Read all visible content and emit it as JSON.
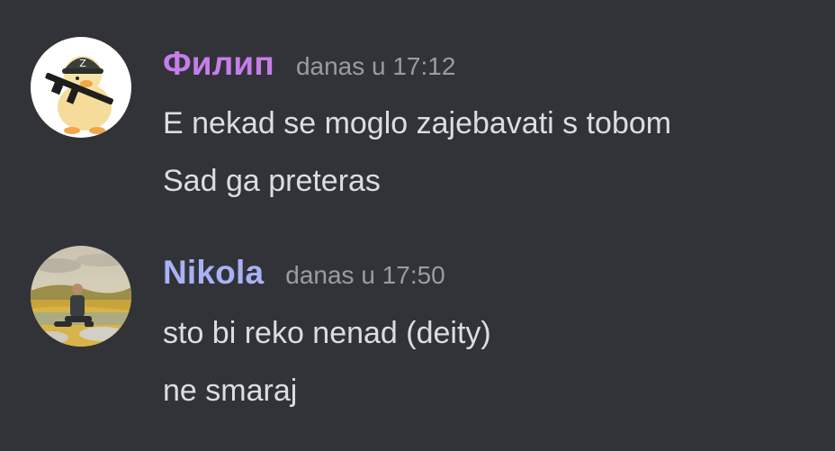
{
  "messages": [
    {
      "username": "Филип",
      "username_color": "#c77dea",
      "timestamp": "danas u 17:12",
      "avatar_icon": "duck-with-rifle-avatar",
      "lines": [
        "E nekad se moglo zajebavati s tobom",
        "Sad ga preteras"
      ]
    },
    {
      "username": "Nikola",
      "username_color": "#a9b2f5",
      "timestamp": "danas u 17:50",
      "avatar_icon": "landscape-photo-avatar",
      "lines": [
        "sto bi reko nenad (deity)",
        "ne smaraj"
      ]
    }
  ]
}
